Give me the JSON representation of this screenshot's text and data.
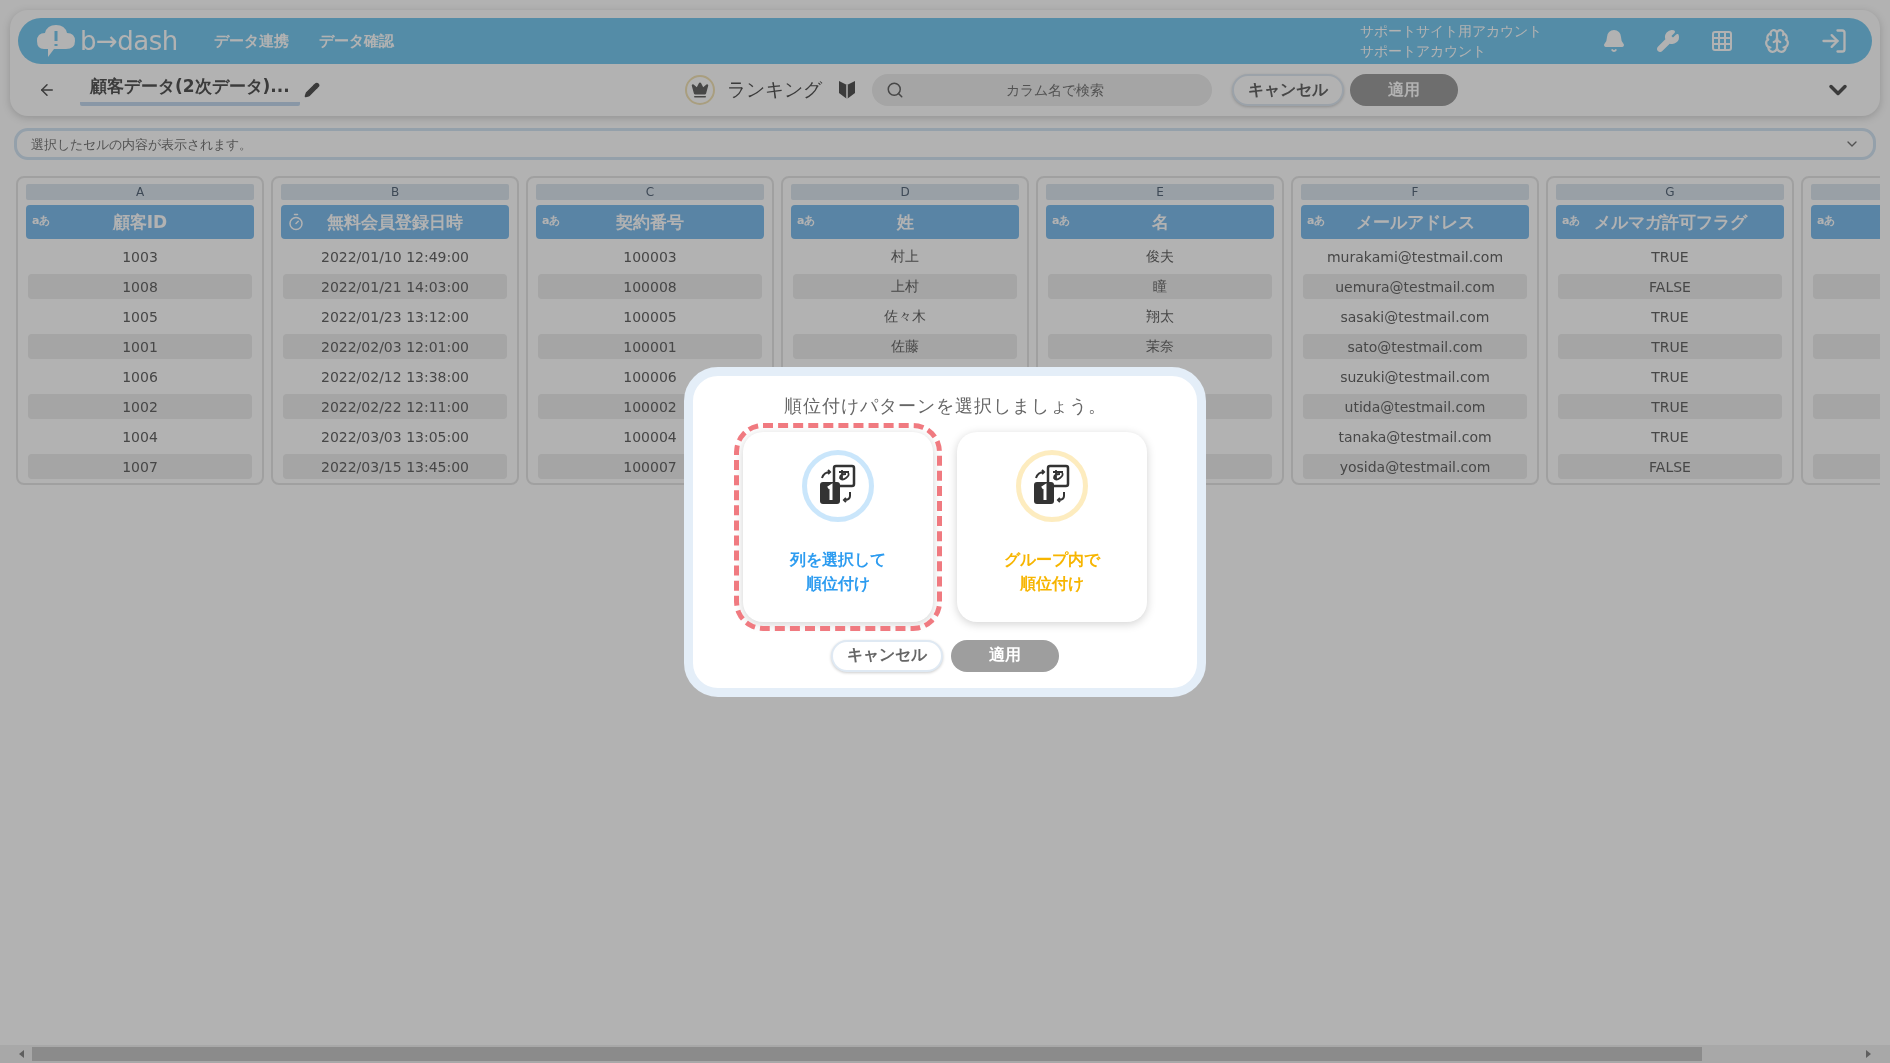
{
  "header": {
    "logo": "b→dash",
    "nav": [
      "データ連携",
      "データ確認"
    ],
    "account": [
      "サポートサイト用アカウント",
      "サポートアカウント"
    ]
  },
  "toolbar": {
    "title": "顧客データ(2次データ)...",
    "mode": "ランキング",
    "search": {
      "placeholder": "カラム名で検索"
    },
    "cancel": "キャンセル",
    "apply": {
      "label": "適用",
      "disabled": true
    }
  },
  "cell_viewer": {
    "placeholder": "選択したセルの内容が表示されます。"
  },
  "columns": [
    {
      "letter": "A",
      "kind": "text",
      "type_label": "aあ",
      "name": "顧客ID",
      "cells": [
        "1003",
        "1008",
        "1005",
        "1001",
        "1006",
        "1002",
        "1004",
        "1007"
      ]
    },
    {
      "letter": "B",
      "kind": "datetime",
      "name": "無料会員登録日時",
      "cells": [
        "2022/01/10 12:49:00",
        "2022/01/21 14:03:00",
        "2022/01/23 13:12:00",
        "2022/02/03 12:01:00",
        "2022/02/12 13:38:00",
        "2022/02/22 12:11:00",
        "2022/03/03 13:05:00",
        "2022/03/15 13:45:00"
      ]
    },
    {
      "letter": "C",
      "kind": "text",
      "type_label": "aあ",
      "name": "契約番号",
      "cells": [
        "100003",
        "100008",
        "100005",
        "100001",
        "100006",
        "100002",
        "100004",
        "100007"
      ]
    },
    {
      "letter": "D",
      "kind": "text",
      "type_label": "aあ",
      "name": "姓",
      "cells": [
        "村上",
        "上村",
        "佐々木",
        "佐藤"
      ]
    },
    {
      "letter": "E",
      "kind": "text",
      "type_label": "aあ",
      "name": "名",
      "cells": [
        "俊夫",
        "瞳",
        "翔太",
        "茉奈"
      ]
    },
    {
      "letter": "F",
      "kind": "text",
      "type_label": "aあ",
      "name": "メールアドレス",
      "cells": [
        "murakami@testmail.com",
        "uemura@testmail.com",
        "sasaki@testmail.com",
        "sato@testmail.com",
        "suzuki@testmail.com",
        "utida@testmail.com",
        "tanaka@testmail.com",
        "yosida@testmail.com"
      ]
    },
    {
      "letter": "G",
      "kind": "text",
      "type_label": "aあ",
      "name": "メルマガ許可フラグ",
      "cells": [
        "TRUE",
        "FALSE",
        "TRUE",
        "TRUE",
        "TRUE",
        "TRUE",
        "TRUE",
        "FALSE"
      ]
    },
    {
      "kind": "text",
      "type_label": "aあ"
    }
  ],
  "dialog": {
    "title": "順位付けパターンを選択しましょう。",
    "options": [
      {
        "label": [
          "列を選択して",
          "順位付け"
        ],
        "selected": true,
        "color": "#2d9cf0"
      },
      {
        "label": [
          "グループ内で",
          "順位付け"
        ],
        "selected": false,
        "color": "#f7b500"
      }
    ],
    "cancel": "キャンセル",
    "apply": {
      "label": "適用",
      "disabled": true
    }
  }
}
